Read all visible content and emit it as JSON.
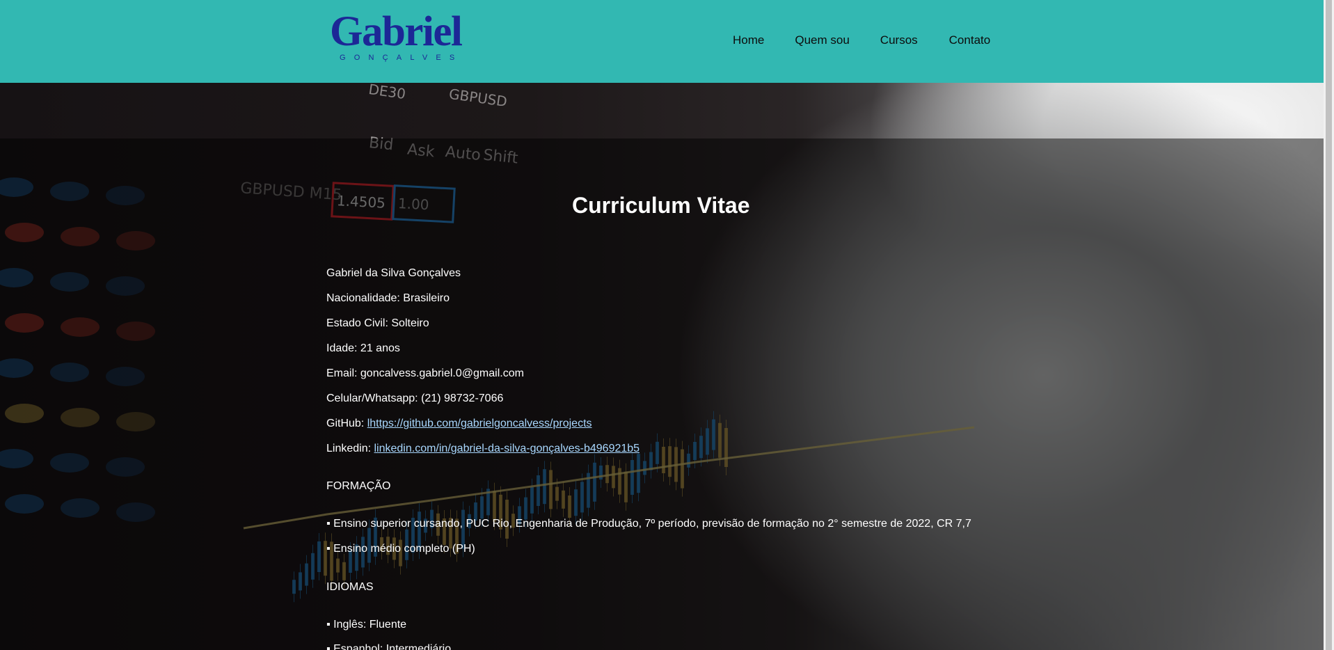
{
  "header": {
    "logo_main": "Gabriel",
    "logo_sub": "GONÇALVES",
    "nav": [
      "Home",
      "Quem sou",
      "Cursos",
      "Contato"
    ]
  },
  "cv": {
    "title": "Curriculum Vitae",
    "name": "Gabriel da Silva Gonçalves",
    "nationality": "Nacionalidade: Brasileiro",
    "civil_status": "Estado Civil: Solteiro",
    "age": "Idade: 21 anos",
    "email": "Email: goncalvess.gabriel.0@gmail.com",
    "phone": "Celular/Whatsapp: (21) 98732-7066",
    "github_label": "GitHub: ",
    "github_link": "lhttps://github.com/gabrielgoncalvess/projects",
    "linkedin_label": "Linkedin: ",
    "linkedin_link": "linkedin.com/in/gabriel-da-silva-gonçalves-b496921b5",
    "formacao_heading": "FORMAÇÃO",
    "formacao": [
      "▪ Ensino superior cursando, PUC Rio, Engenharia de Produção, 7º período, previsão de formação no 2° semestre de 2022, CR 7,7",
      "▪ Ensino médio completo (PH)"
    ],
    "idiomas_heading": "IDIOMAS",
    "idiomas": [
      "▪ Inglês: Fluente",
      "▪ Espanhol: Intermediário"
    ]
  },
  "colors": {
    "header_bg": "#32b8b2",
    "logo": "#1c2796",
    "link": "#a9d8ff"
  }
}
